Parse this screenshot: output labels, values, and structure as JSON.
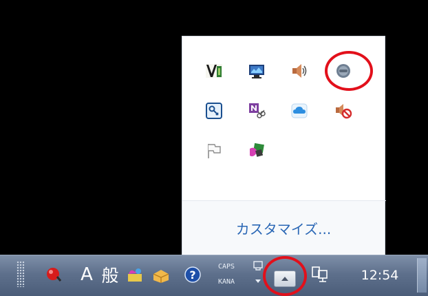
{
  "tray_popup": {
    "icons": [
      {
        "name": "veeam-icon"
      },
      {
        "name": "network-monitor-icon"
      },
      {
        "name": "speaker-icon"
      },
      {
        "name": "gray-circle-icon"
      },
      {
        "name": "key-tool-icon"
      },
      {
        "name": "onenote-clip-icon"
      },
      {
        "name": "cloud-icon"
      },
      {
        "name": "speaker-muted-icon"
      },
      {
        "name": "action-center-flag-icon"
      },
      {
        "name": "ime-tools-icon"
      }
    ],
    "customize_label": "カスタマイズ..."
  },
  "taskbar": {
    "ime_mode": "A",
    "ime_dictionary": "般",
    "caps_label": "CAPS",
    "kana_label": "KANA",
    "clock": "12:54"
  },
  "colors": {
    "highlight_ring": "#e2101b",
    "link": "#2a67b5"
  }
}
